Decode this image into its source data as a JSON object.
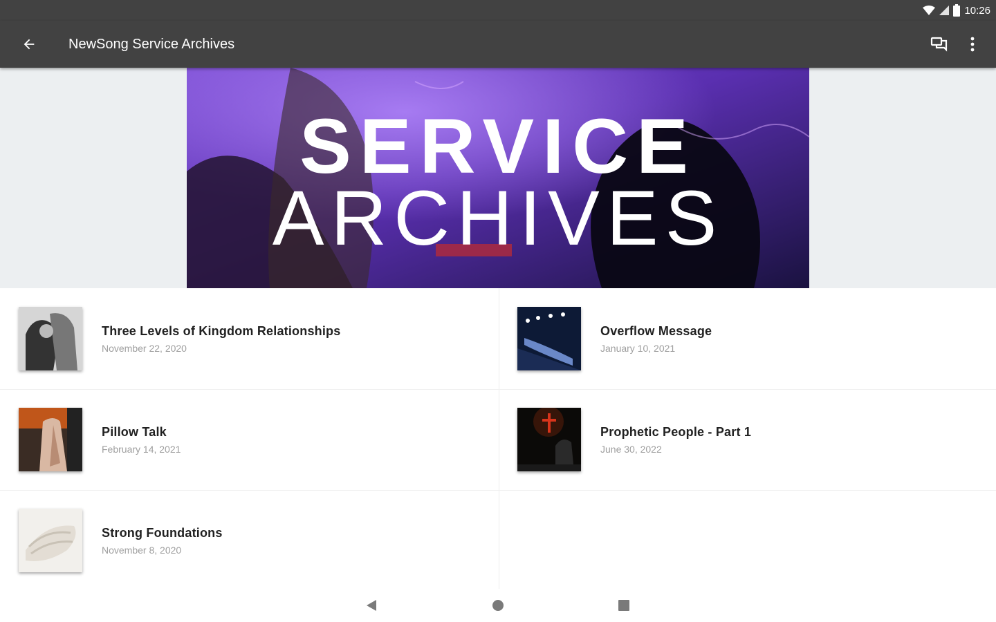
{
  "status_bar": {
    "time": "10:26"
  },
  "app_bar": {
    "title": "NewSong Service Archives"
  },
  "hero": {
    "line1": "SERVICE",
    "line2": "ARCHIVES"
  },
  "items": [
    {
      "title": "Three Levels of Kingdom Relationships",
      "date": "November 22, 2020"
    },
    {
      "title": "Overflow Message",
      "date": "January 10, 2021"
    },
    {
      "title": "Pillow Talk",
      "date": "February 14, 2021"
    },
    {
      "title": "Prophetic People - Part 1",
      "date": "June 30, 2022"
    },
    {
      "title": "Strong Foundations",
      "date": "November 8, 2020"
    }
  ],
  "colors": {
    "app_bar": "#424242",
    "hero_background": "#eceff1",
    "title_text": "#212121",
    "date_text": "#9e9e9e"
  },
  "icons": {
    "back": "arrow-back-icon",
    "cast": "chat-bubbles-icon",
    "more": "more-vert-icon",
    "nav_back": "nav-back-triangle-icon",
    "nav_home": "nav-home-circle-icon",
    "nav_recents": "nav-recents-square-icon"
  }
}
